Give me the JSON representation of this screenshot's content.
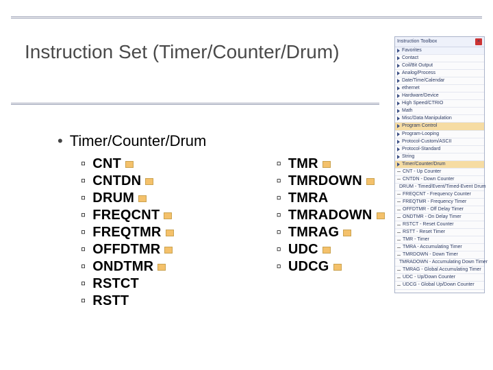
{
  "title": "Instruction Set (Timer/Counter/Drum)",
  "heading": "Timer/Counter/Drum",
  "col1": [
    "CNT",
    "CNTDN",
    "DRUM",
    "FREQCNT",
    "FREQTMR",
    "OFFDTMR",
    "ONDTMR",
    "RSTCT",
    "RSTT"
  ],
  "col2": [
    "TMR",
    "TMRDOWN",
    "TMRA",
    "TMRADOWN",
    "TMRAG",
    "UDC",
    "UDCG"
  ],
  "chip_items": [
    "CNT",
    "CNTDN",
    "DRUM",
    "FREQCNT",
    "FREQTMR",
    "OFFDTMR",
    "ONDTMR",
    "TMR",
    "TMRDOWN",
    "TMRADOWN",
    "TMRAG",
    "UDC",
    "UDCG"
  ],
  "panel": {
    "title": "Instruction Toolbox",
    "close": "×",
    "groups": [
      {
        "label": "Favorites",
        "hdr": true
      },
      {
        "label": "Contact"
      },
      {
        "label": "Coil/Bit Output"
      },
      {
        "label": "Analog/Process"
      },
      {
        "label": "Date/Time/Calendar"
      },
      {
        "label": "ethernet"
      },
      {
        "label": "Hardware/Device"
      },
      {
        "label": "High Speed/CTRIO"
      },
      {
        "label": "Math"
      },
      {
        "label": "Misc/Data Manipulation"
      },
      {
        "label": "Program Control",
        "sel": true
      },
      {
        "label": "Program-Looping"
      },
      {
        "label": "Protocol-Custom/ASCII"
      },
      {
        "label": "Protocol-Standard"
      },
      {
        "label": "String"
      },
      {
        "label": "Timer/Counter/Drum",
        "sel": true
      }
    ],
    "items": [
      "CNT - Up Counter",
      "CNTDN - Down Counter",
      "DRUM - Timed/Event/Timed-Event Drum",
      "FREQCNT - Frequency Counter",
      "FREQTMR - Frequency Timer",
      "OFFDTMR - Off Delay Timer",
      "ONDTMR - On Delay Timer",
      "RSTCT - Reset Counter",
      "RSTT - Reset Timer",
      "TMR - Timer",
      "TMRA - Accumulating Timer",
      "TMRDOWN - Down Timer",
      "TMRADOWN - Accumulating Down Timer",
      "TMRAG - Global Accumulating Timer",
      "UDC - Up/Down Counter",
      "UDCG - Global Up/Down Counter"
    ]
  }
}
